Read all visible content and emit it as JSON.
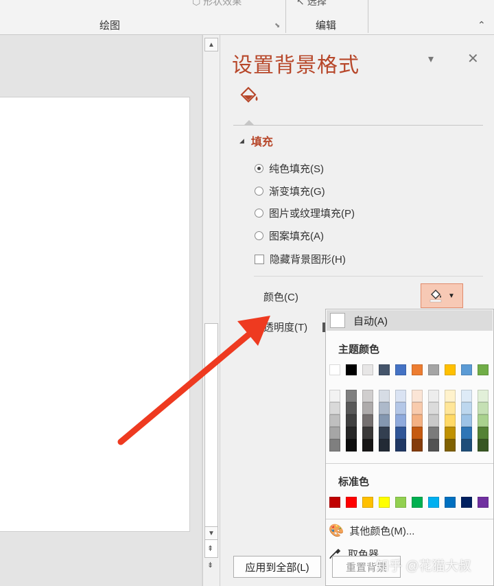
{
  "ribbon": {
    "drawing_group": "绘图",
    "editing_group": "编辑",
    "shape_effects_label": "形状效果",
    "select_label": "选择"
  },
  "pane": {
    "title": "设置背景格式",
    "fill_section": "填充",
    "fill_options": [
      "纯色填充(S)",
      "渐变填充(G)",
      "图片或纹理填充(P)",
      "图案填充(A)"
    ],
    "hide_bg_graphics": "隐藏背景图形(H)",
    "color_label": "颜色(C)",
    "transparency_label": "透明度(T)",
    "apply_all": "应用到全部(L)",
    "reset_background": "重置背景"
  },
  "palette": {
    "auto": "自动(A)",
    "theme_colors_label": "主题颜色",
    "standard_colors_label": "标准色",
    "more_colors": "其他颜色(M)...",
    "eyedropper": "取色器",
    "theme_top": [
      "#ffffff",
      "#000000",
      "#e7e6e6",
      "#44546a",
      "#4472c4",
      "#ed7d31",
      "#a5a5a5",
      "#ffc000",
      "#5b9bd5",
      "#70ad47"
    ],
    "theme_shades": [
      [
        "#f2f2f2",
        "#d9d9d9",
        "#bfbfbf",
        "#a6a6a6",
        "#7f7f7f"
      ],
      [
        "#7f7f7f",
        "#595959",
        "#404040",
        "#262626",
        "#0d0d0d"
      ],
      [
        "#d0cece",
        "#aeabab",
        "#757070",
        "#3a3838",
        "#171616"
      ],
      [
        "#d6dce5",
        "#adb9ca",
        "#8497b0",
        "#333f50",
        "#222a35"
      ],
      [
        "#dae3f3",
        "#b4c7e7",
        "#8faadc",
        "#2f5597",
        "#203864"
      ],
      [
        "#fbe5d6",
        "#f8cbad",
        "#f4b183",
        "#c55a11",
        "#843c0c"
      ],
      [
        "#ededed",
        "#dbdbdb",
        "#c9c9c9",
        "#7b7b7b",
        "#525252"
      ],
      [
        "#fff2cc",
        "#ffe699",
        "#ffd966",
        "#bf9000",
        "#7f6000"
      ],
      [
        "#deebf7",
        "#bdd7ee",
        "#9dc3e6",
        "#2e75b6",
        "#1f4e79"
      ],
      [
        "#e2f0d9",
        "#c5e0b4",
        "#a9d18e",
        "#548235",
        "#385723"
      ]
    ],
    "standard": [
      "#c00000",
      "#ff0000",
      "#ffc000",
      "#ffff00",
      "#92d050",
      "#00b050",
      "#00b0f0",
      "#0070c0",
      "#002060",
      "#7030a0"
    ]
  },
  "watermark": "知乎 @花猫大叔",
  "arrow_color": "#ee3a20"
}
